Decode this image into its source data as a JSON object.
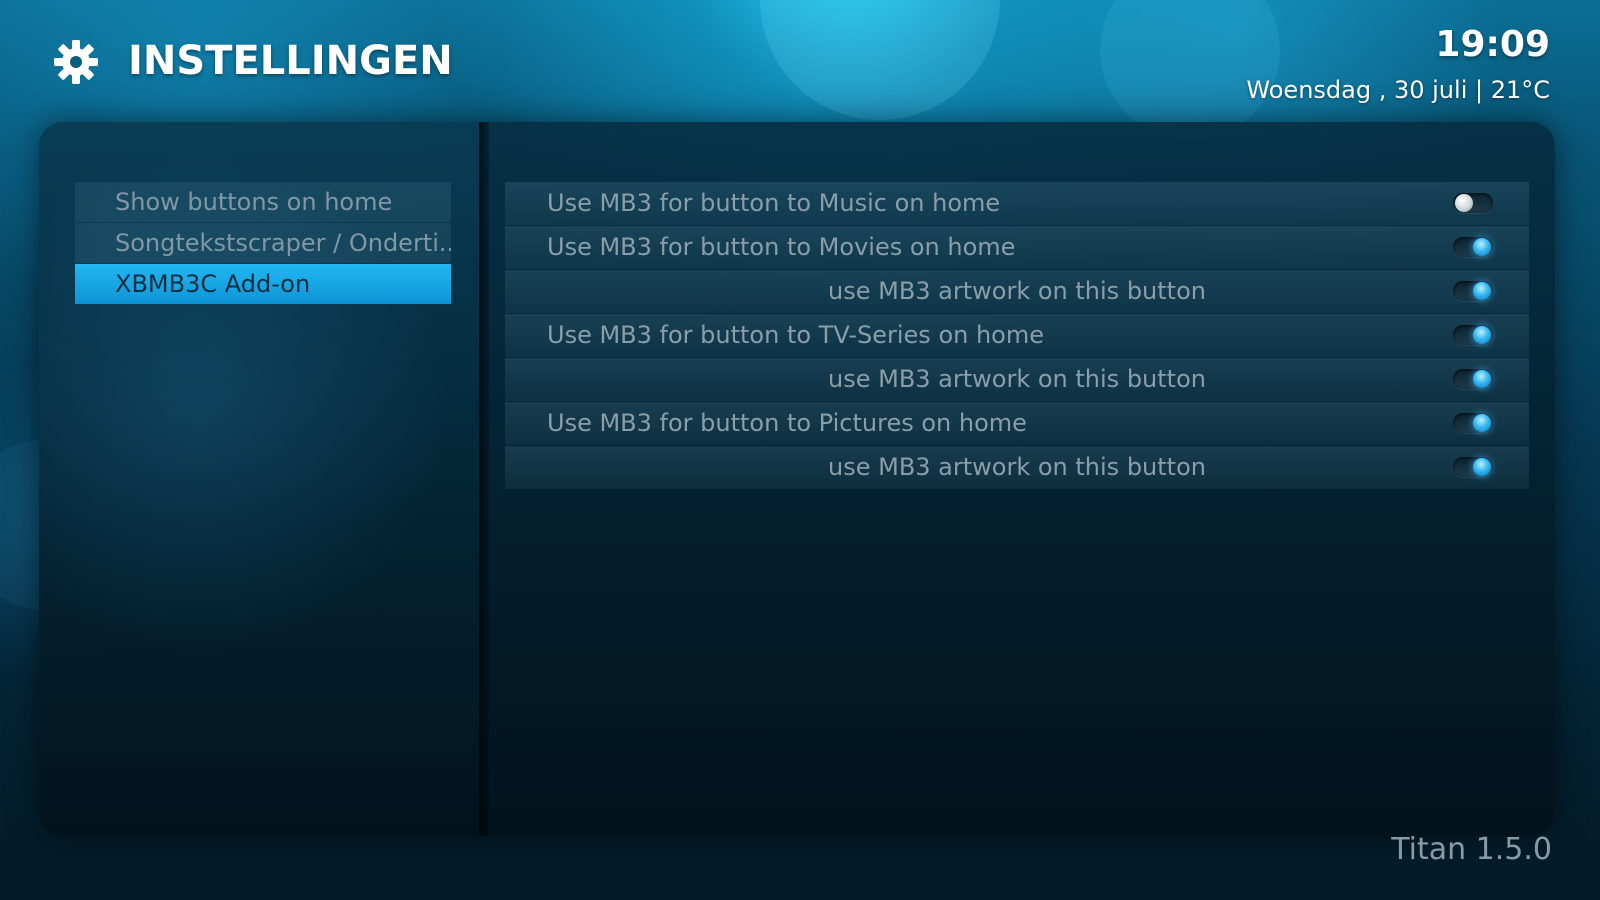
{
  "header": {
    "title": "INSTELLINGEN",
    "time": "19:09",
    "date_weather": "Woensdag , 30 juli | 21°C",
    "icon": "gear-icon"
  },
  "sidebar": {
    "items": [
      {
        "label": "Show buttons on home",
        "active": false
      },
      {
        "label": "Songtekstscraper / Onderti...",
        "active": false
      },
      {
        "label": "XBMB3C Add-on",
        "active": true
      }
    ]
  },
  "settings": {
    "rows": [
      {
        "label": "Use MB3 for button to Music on home",
        "sub": false,
        "enabled": false
      },
      {
        "label": "Use MB3 for button to Movies on home",
        "sub": false,
        "enabled": true
      },
      {
        "label": "use MB3 artwork on this button",
        "sub": true,
        "enabled": true
      },
      {
        "label": "Use MB3 for button to TV-Series on home",
        "sub": false,
        "enabled": true
      },
      {
        "label": "use MB3 artwork on this button",
        "sub": true,
        "enabled": true
      },
      {
        "label": "Use MB3 for button to Pictures on home",
        "sub": false,
        "enabled": true
      },
      {
        "label": "use MB3 artwork on this button",
        "sub": true,
        "enabled": true
      }
    ]
  },
  "footer": {
    "skin_version": "Titan 1.5.0"
  },
  "colors": {
    "accent": "#1aa8e8",
    "toggle_on": "#35b8f5",
    "text_dim": "#8a9ea9"
  }
}
